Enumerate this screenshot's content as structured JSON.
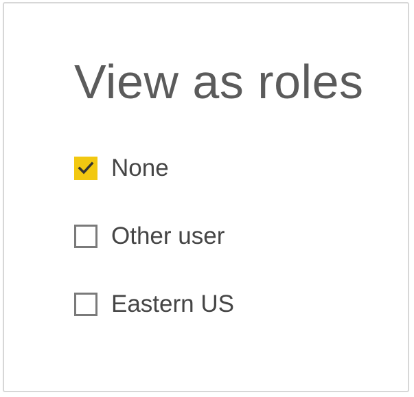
{
  "dialog": {
    "title": "View as roles"
  },
  "roles": [
    {
      "label": "None",
      "checked": true
    },
    {
      "label": "Other user",
      "checked": false
    },
    {
      "label": "Eastern US",
      "checked": false
    }
  ],
  "colors": {
    "accent": "#f2c811",
    "checkbox_border": "#7a7a7a",
    "text": "#454545",
    "title": "#5b5b5b"
  },
  "icons": {
    "check": "check-icon"
  }
}
